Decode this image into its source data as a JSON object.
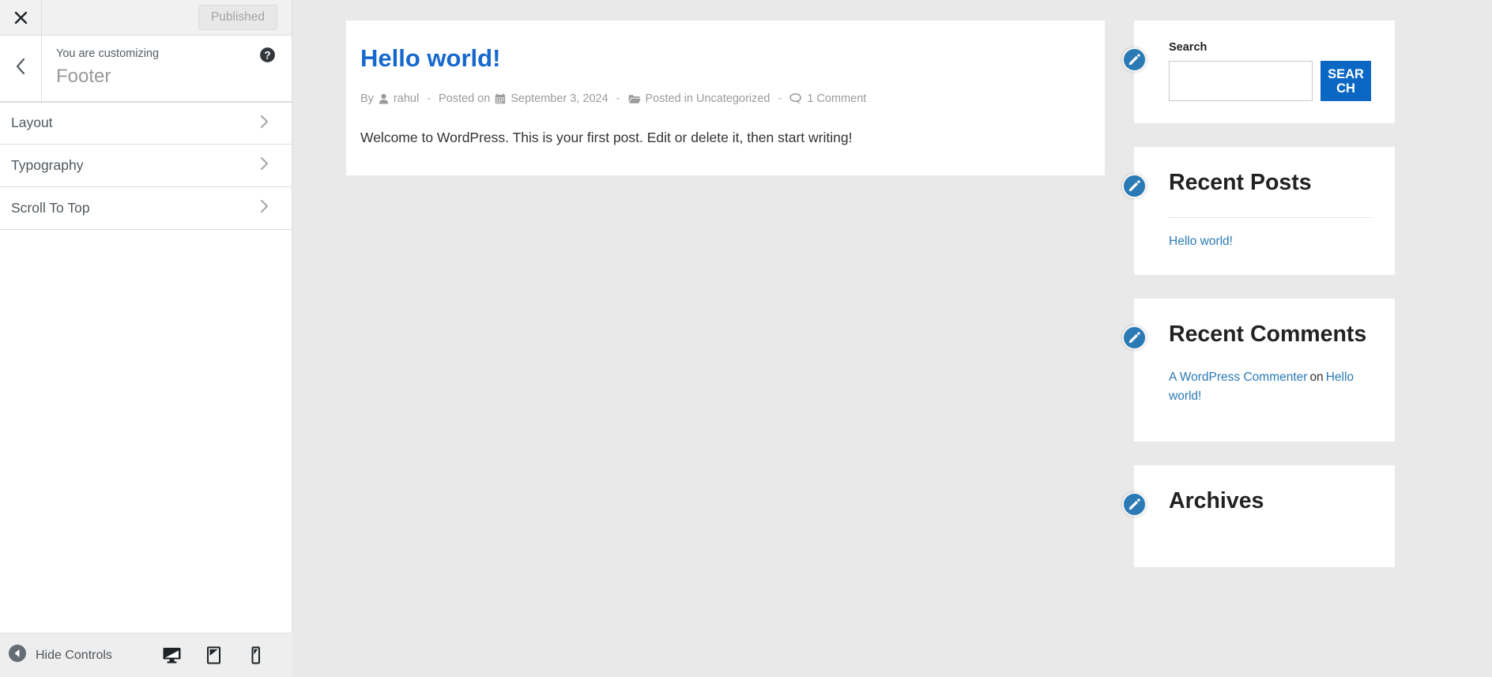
{
  "customizer": {
    "close_icon": "close-x-icon",
    "published_label": "Published",
    "back_icon": "chevron-left-icon",
    "breadcrumb": "You are customizing",
    "panel_title": "Footer",
    "help_icon": "help-question-icon",
    "items": [
      {
        "label": "Layout",
        "arrow_icon": "chevron-right-icon"
      },
      {
        "label": "Typography",
        "arrow_icon": "chevron-right-icon"
      },
      {
        "label": "Scroll To Top",
        "arrow_icon": "chevron-right-icon"
      }
    ],
    "footer": {
      "hide_controls_label": "Hide Controls",
      "hide_controls_icon": "collapse-left-arrow-icon",
      "devices": [
        {
          "name": "desktop",
          "icon": "desktop-icon",
          "active": true
        },
        {
          "name": "tablet",
          "icon": "tablet-icon",
          "active": false
        },
        {
          "name": "mobile",
          "icon": "mobile-icon",
          "active": false
        }
      ]
    }
  },
  "preview": {
    "post": {
      "title": "Hello world!",
      "meta": {
        "by_label": "By",
        "author_icon": "user-icon",
        "author": "rahul",
        "posted_on_label": "Posted on",
        "date_icon": "calendar-icon",
        "date": "September 3, 2024",
        "category_icon": "folder-icon",
        "posted_in": "Posted in Uncategorized",
        "comment_icon": "comment-bubble-icon",
        "comments": "1 Comment",
        "separator": "-"
      },
      "excerpt": "Welcome to WordPress. This is your first post. Edit or delete it, then start writing!"
    },
    "widgets": {
      "edit_icon": "pencil-edit-icon",
      "search": {
        "title": "Search",
        "input_value": "",
        "input_placeholder": "",
        "button_label": "SEARCH"
      },
      "recent_posts": {
        "title": "Recent Posts",
        "links": [
          "Hello world!"
        ]
      },
      "recent_comments": {
        "title": "Recent Comments",
        "entries": [
          {
            "author": "A WordPress Commenter",
            "on": "on",
            "post": "Hello world!"
          }
        ]
      },
      "archives": {
        "title": "Archives"
      }
    }
  },
  "colors": {
    "accent_blue": "#2b7ab5",
    "link_blue": "#1668ce",
    "button_blue": "#0a67c4",
    "preview_bg": "#e9e9e9",
    "sidebar_bg": "#ffffff"
  }
}
